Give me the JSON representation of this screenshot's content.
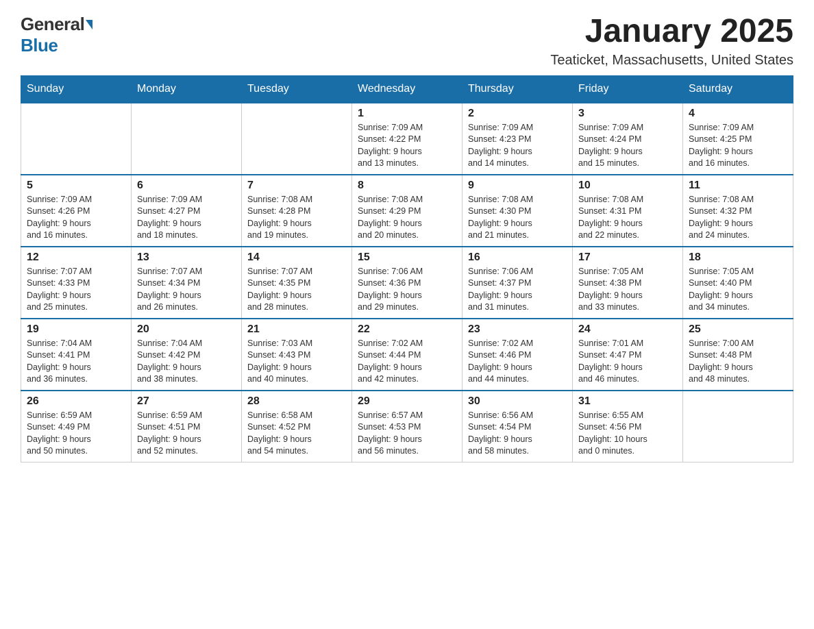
{
  "header": {
    "logo_general": "General",
    "logo_blue": "Blue",
    "month_title": "January 2025",
    "location": "Teaticket, Massachusetts, United States"
  },
  "weekdays": [
    "Sunday",
    "Monday",
    "Tuesday",
    "Wednesday",
    "Thursday",
    "Friday",
    "Saturday"
  ],
  "weeks": [
    [
      {
        "day": "",
        "info": ""
      },
      {
        "day": "",
        "info": ""
      },
      {
        "day": "",
        "info": ""
      },
      {
        "day": "1",
        "info": "Sunrise: 7:09 AM\nSunset: 4:22 PM\nDaylight: 9 hours\nand 13 minutes."
      },
      {
        "day": "2",
        "info": "Sunrise: 7:09 AM\nSunset: 4:23 PM\nDaylight: 9 hours\nand 14 minutes."
      },
      {
        "day": "3",
        "info": "Sunrise: 7:09 AM\nSunset: 4:24 PM\nDaylight: 9 hours\nand 15 minutes."
      },
      {
        "day": "4",
        "info": "Sunrise: 7:09 AM\nSunset: 4:25 PM\nDaylight: 9 hours\nand 16 minutes."
      }
    ],
    [
      {
        "day": "5",
        "info": "Sunrise: 7:09 AM\nSunset: 4:26 PM\nDaylight: 9 hours\nand 16 minutes."
      },
      {
        "day": "6",
        "info": "Sunrise: 7:09 AM\nSunset: 4:27 PM\nDaylight: 9 hours\nand 18 minutes."
      },
      {
        "day": "7",
        "info": "Sunrise: 7:08 AM\nSunset: 4:28 PM\nDaylight: 9 hours\nand 19 minutes."
      },
      {
        "day": "8",
        "info": "Sunrise: 7:08 AM\nSunset: 4:29 PM\nDaylight: 9 hours\nand 20 minutes."
      },
      {
        "day": "9",
        "info": "Sunrise: 7:08 AM\nSunset: 4:30 PM\nDaylight: 9 hours\nand 21 minutes."
      },
      {
        "day": "10",
        "info": "Sunrise: 7:08 AM\nSunset: 4:31 PM\nDaylight: 9 hours\nand 22 minutes."
      },
      {
        "day": "11",
        "info": "Sunrise: 7:08 AM\nSunset: 4:32 PM\nDaylight: 9 hours\nand 24 minutes."
      }
    ],
    [
      {
        "day": "12",
        "info": "Sunrise: 7:07 AM\nSunset: 4:33 PM\nDaylight: 9 hours\nand 25 minutes."
      },
      {
        "day": "13",
        "info": "Sunrise: 7:07 AM\nSunset: 4:34 PM\nDaylight: 9 hours\nand 26 minutes."
      },
      {
        "day": "14",
        "info": "Sunrise: 7:07 AM\nSunset: 4:35 PM\nDaylight: 9 hours\nand 28 minutes."
      },
      {
        "day": "15",
        "info": "Sunrise: 7:06 AM\nSunset: 4:36 PM\nDaylight: 9 hours\nand 29 minutes."
      },
      {
        "day": "16",
        "info": "Sunrise: 7:06 AM\nSunset: 4:37 PM\nDaylight: 9 hours\nand 31 minutes."
      },
      {
        "day": "17",
        "info": "Sunrise: 7:05 AM\nSunset: 4:38 PM\nDaylight: 9 hours\nand 33 minutes."
      },
      {
        "day": "18",
        "info": "Sunrise: 7:05 AM\nSunset: 4:40 PM\nDaylight: 9 hours\nand 34 minutes."
      }
    ],
    [
      {
        "day": "19",
        "info": "Sunrise: 7:04 AM\nSunset: 4:41 PM\nDaylight: 9 hours\nand 36 minutes."
      },
      {
        "day": "20",
        "info": "Sunrise: 7:04 AM\nSunset: 4:42 PM\nDaylight: 9 hours\nand 38 minutes."
      },
      {
        "day": "21",
        "info": "Sunrise: 7:03 AM\nSunset: 4:43 PM\nDaylight: 9 hours\nand 40 minutes."
      },
      {
        "day": "22",
        "info": "Sunrise: 7:02 AM\nSunset: 4:44 PM\nDaylight: 9 hours\nand 42 minutes."
      },
      {
        "day": "23",
        "info": "Sunrise: 7:02 AM\nSunset: 4:46 PM\nDaylight: 9 hours\nand 44 minutes."
      },
      {
        "day": "24",
        "info": "Sunrise: 7:01 AM\nSunset: 4:47 PM\nDaylight: 9 hours\nand 46 minutes."
      },
      {
        "day": "25",
        "info": "Sunrise: 7:00 AM\nSunset: 4:48 PM\nDaylight: 9 hours\nand 48 minutes."
      }
    ],
    [
      {
        "day": "26",
        "info": "Sunrise: 6:59 AM\nSunset: 4:49 PM\nDaylight: 9 hours\nand 50 minutes."
      },
      {
        "day": "27",
        "info": "Sunrise: 6:59 AM\nSunset: 4:51 PM\nDaylight: 9 hours\nand 52 minutes."
      },
      {
        "day": "28",
        "info": "Sunrise: 6:58 AM\nSunset: 4:52 PM\nDaylight: 9 hours\nand 54 minutes."
      },
      {
        "day": "29",
        "info": "Sunrise: 6:57 AM\nSunset: 4:53 PM\nDaylight: 9 hours\nand 56 minutes."
      },
      {
        "day": "30",
        "info": "Sunrise: 6:56 AM\nSunset: 4:54 PM\nDaylight: 9 hours\nand 58 minutes."
      },
      {
        "day": "31",
        "info": "Sunrise: 6:55 AM\nSunset: 4:56 PM\nDaylight: 10 hours\nand 0 minutes."
      },
      {
        "day": "",
        "info": ""
      }
    ]
  ]
}
